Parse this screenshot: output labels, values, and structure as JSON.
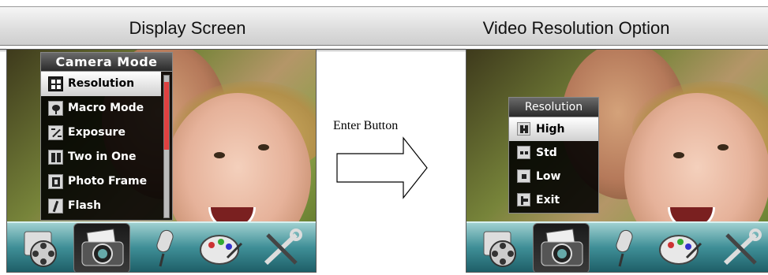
{
  "left_panel": {
    "title": "Display Screen",
    "menu": {
      "title": "Camera Mode",
      "items": [
        {
          "label": "Resolution",
          "icon": "resolution-icon",
          "selected": true
        },
        {
          "label": "Macro Mode",
          "icon": "macro-icon",
          "selected": false
        },
        {
          "label": "Exposure",
          "icon": "exposure-icon",
          "selected": false
        },
        {
          "label": "Two in One",
          "icon": "two-in-one-icon",
          "selected": false
        },
        {
          "label": "Photo Frame",
          "icon": "photo-frame-icon",
          "selected": false
        },
        {
          "label": "Flash",
          "icon": "flash-icon",
          "selected": false
        }
      ]
    },
    "icon_bar": [
      "video-mode-icon",
      "camera-mode-icon",
      "voice-mode-icon",
      "playback-palette-icon",
      "setup-tools-icon"
    ],
    "active_tab": "camera-mode-icon"
  },
  "middle": {
    "label": "Enter Button",
    "arrow": "right-arrow-icon"
  },
  "right_panel": {
    "title": "Video Resolution Option",
    "menu": {
      "title": "Resolution",
      "items": [
        {
          "label": "High",
          "icon": "high-res-icon",
          "selected": true
        },
        {
          "label": "Std",
          "icon": "std-res-icon",
          "selected": false
        },
        {
          "label": "Low",
          "icon": "low-res-icon",
          "selected": false
        },
        {
          "label": "Exit",
          "icon": "exit-icon",
          "selected": false
        }
      ]
    },
    "icon_bar": [
      "video-mode-icon",
      "camera-mode-icon",
      "voice-mode-icon",
      "playback-palette-icon",
      "setup-tools-icon"
    ],
    "active_tab": "camera-mode-icon"
  },
  "colors": {
    "header_bg": "#dcdcdc",
    "menu_bg": "#000000",
    "menu_selected_bg": "#ffffff",
    "scrollbar_thumb": "#e04040",
    "icon_bar_teal": "#3f8f97"
  }
}
